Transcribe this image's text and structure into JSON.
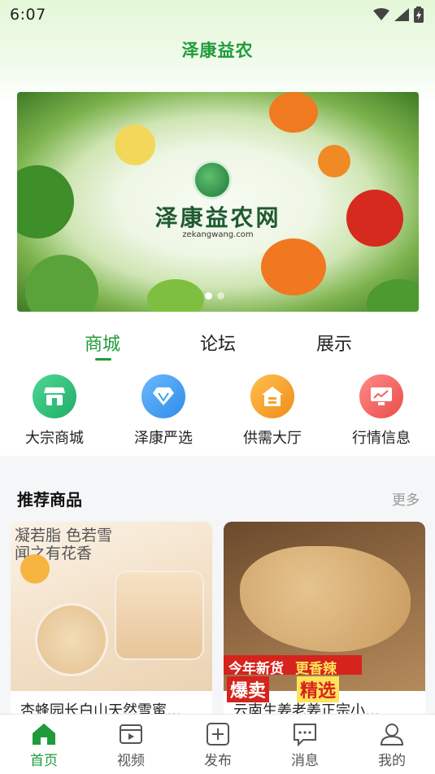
{
  "status": {
    "time": "6:07"
  },
  "header": {
    "title": "泽康益农"
  },
  "banner": {
    "title": "泽康益农网",
    "subtitle": "zekangwang.com",
    "active_index": 0,
    "count": 2
  },
  "tabs": [
    {
      "label": "商城",
      "active": true
    },
    {
      "label": "论坛",
      "active": false
    },
    {
      "label": "展示",
      "active": false
    }
  ],
  "categories": [
    {
      "label": "大宗商城",
      "icon": "store-icon",
      "color": "#2ec07a"
    },
    {
      "label": "泽康严选",
      "icon": "diamond-icon",
      "color": "#3d9ef0"
    },
    {
      "label": "供需大厅",
      "icon": "hall-icon",
      "color": "#f5a623"
    },
    {
      "label": "行情信息",
      "icon": "chart-icon",
      "color": "#f0625f"
    }
  ],
  "recommend": {
    "title": "推荐商品",
    "more": "更多",
    "products": [
      {
        "title": "杏蜂园长白山天然雪蜜…",
        "img_text_1": "凝若脂 色若雪",
        "img_text_2": "闻之有花香"
      },
      {
        "title": "云南生姜老姜正宗小…",
        "img_text_1": "今年新货",
        "img_text_2": "更香辣",
        "img_text_3": "爆卖",
        "img_text_4": "精选"
      }
    ]
  },
  "tabbar": [
    {
      "label": "首页",
      "icon": "home-icon",
      "active": true
    },
    {
      "label": "视频",
      "icon": "video-icon",
      "active": false
    },
    {
      "label": "发布",
      "icon": "publish-icon",
      "active": false
    },
    {
      "label": "消息",
      "icon": "message-icon",
      "active": false
    },
    {
      "label": "我的",
      "icon": "profile-icon",
      "active": false
    }
  ],
  "colors": {
    "accent": "#1f9b3a",
    "inactive": "#555555"
  }
}
